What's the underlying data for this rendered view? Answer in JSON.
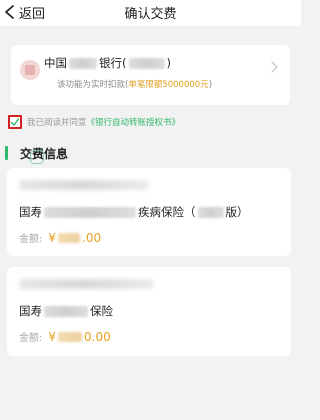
{
  "nav": {
    "back_label": "返回",
    "title": "确认交费"
  },
  "bank": {
    "name_prefix": "中国",
    "name_suffix": "银行",
    "name_paren": "(",
    "name_paren_close": ")",
    "desc_prefix": "该功能为实时扣款(",
    "desc_limit": "单笔限额5000000元",
    "desc_suffix": ")"
  },
  "agreement": {
    "checked": true,
    "prefix": "我已阅读并同意",
    "link": "《银行自动转账授权书》"
  },
  "section": {
    "title": "交费信息"
  },
  "policies": [
    {
      "name_prefix": "国寿",
      "name_suffix": "疾病保险（",
      "name_year": "版）",
      "amount_label": "金额:",
      "amount_symbol": "¥",
      "amount_tail": ".00"
    },
    {
      "name_prefix": "国寿",
      "name_suffix": "保险",
      "amount_label": "金额:",
      "amount_symbol": "¥",
      "amount_tail": "0.00"
    }
  ],
  "colors": {
    "accent_green": "#2fb86e",
    "amount_orange": "#e8a020",
    "highlight_red": "#d42020"
  }
}
